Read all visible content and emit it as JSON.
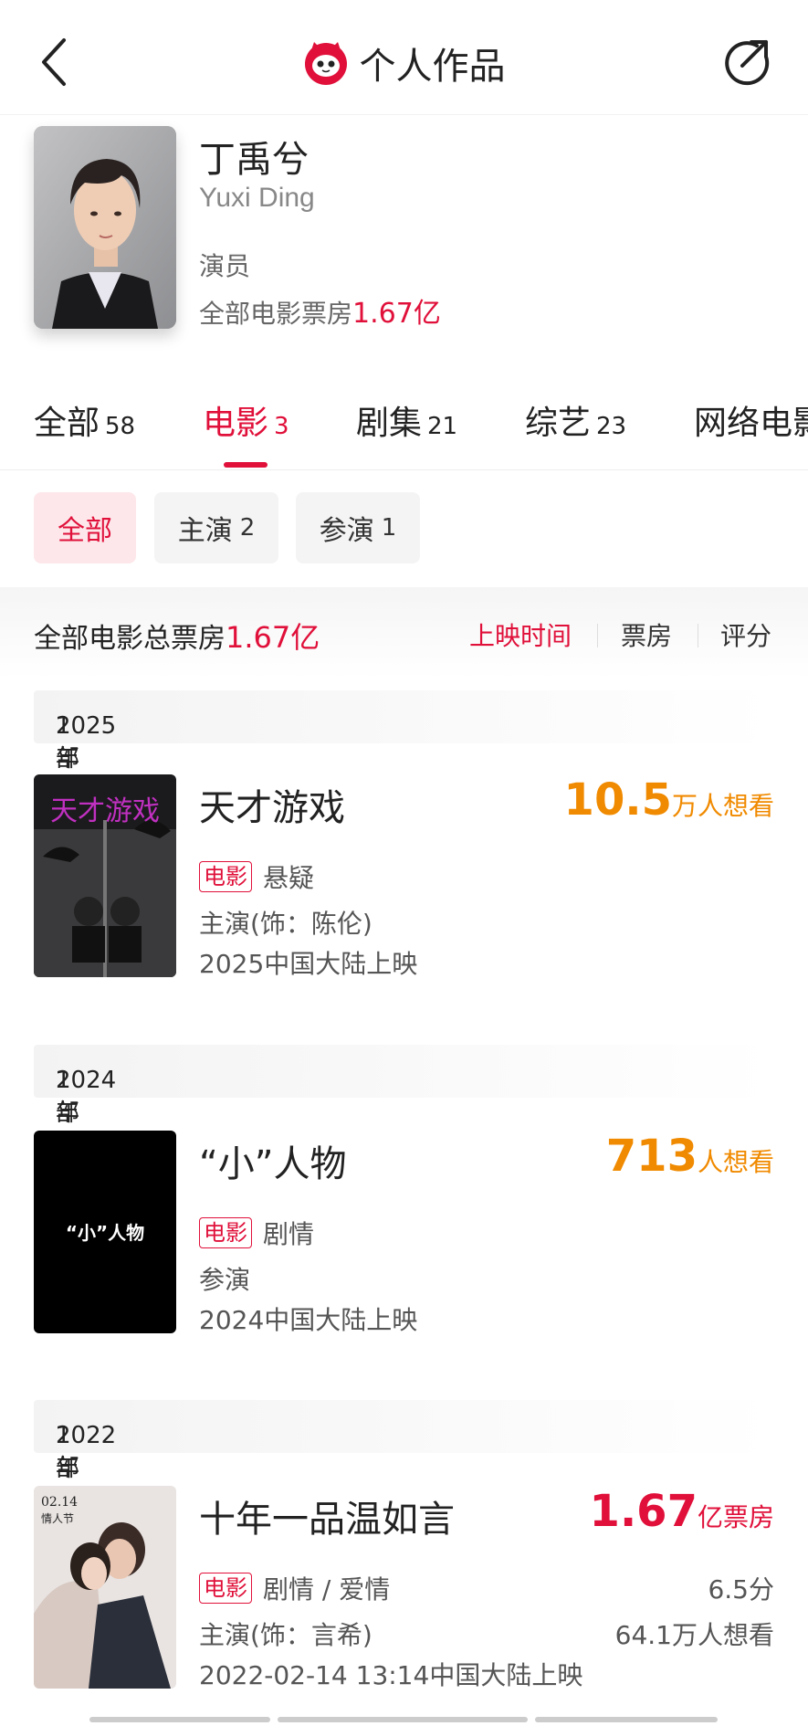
{
  "header": {
    "title": "个人作品"
  },
  "profile": {
    "name_cn": "丁禹兮",
    "name_en": "Yuxi Ding",
    "role": "演员",
    "boxoffice_label": "全部电影票房",
    "boxoffice_value": "1.67亿"
  },
  "tabs": [
    {
      "label": "全部",
      "count": "58"
    },
    {
      "label": "电影",
      "count": "3"
    },
    {
      "label": "剧集",
      "count": "21"
    },
    {
      "label": "综艺",
      "count": "23"
    },
    {
      "label": "网络电影",
      "count": ""
    }
  ],
  "filters": [
    {
      "label": "全部",
      "count": ""
    },
    {
      "label": "主演",
      "count": "2"
    },
    {
      "label": "参演",
      "count": "1"
    }
  ],
  "summary": {
    "label": "全部电影总票房",
    "value": "1.67亿",
    "sort_options": [
      "上映时间",
      "票房",
      "评分"
    ]
  },
  "years": [
    {
      "year": "2025年",
      "count": "1部"
    },
    {
      "year": "2024年",
      "count": "1部"
    },
    {
      "year": "2022年",
      "count": "1部"
    }
  ],
  "movies": [
    {
      "title": "天才游戏",
      "metric_big": "10.5",
      "metric_small": "万人想看",
      "tag": "电影",
      "genre": "悬疑",
      "role": "主演(饰：陈伦)",
      "release": "2025中国大陆上映",
      "poster_title": "天才游戏"
    },
    {
      "title": "“小”人物",
      "metric_big": "713",
      "metric_small": "人想看",
      "tag": "电影",
      "genre": "剧情",
      "role": "参演",
      "release": "2024中国大陆上映",
      "poster_title": "“小”人物"
    },
    {
      "title": "十年一品温如言",
      "metric_big": "1.67",
      "metric_small": "亿票房",
      "tag": "电影",
      "genre": "剧情 / 爱情",
      "role": "主演(饰：言希)",
      "release": "2022-02-14 13:14中国大陆上映",
      "score": "6.5分",
      "want": "64.1万人想看",
      "poster_date": "02.14",
      "poster_sub": "情人节"
    }
  ],
  "colors": {
    "accent": "#e0103a",
    "orange": "#f08a00"
  }
}
